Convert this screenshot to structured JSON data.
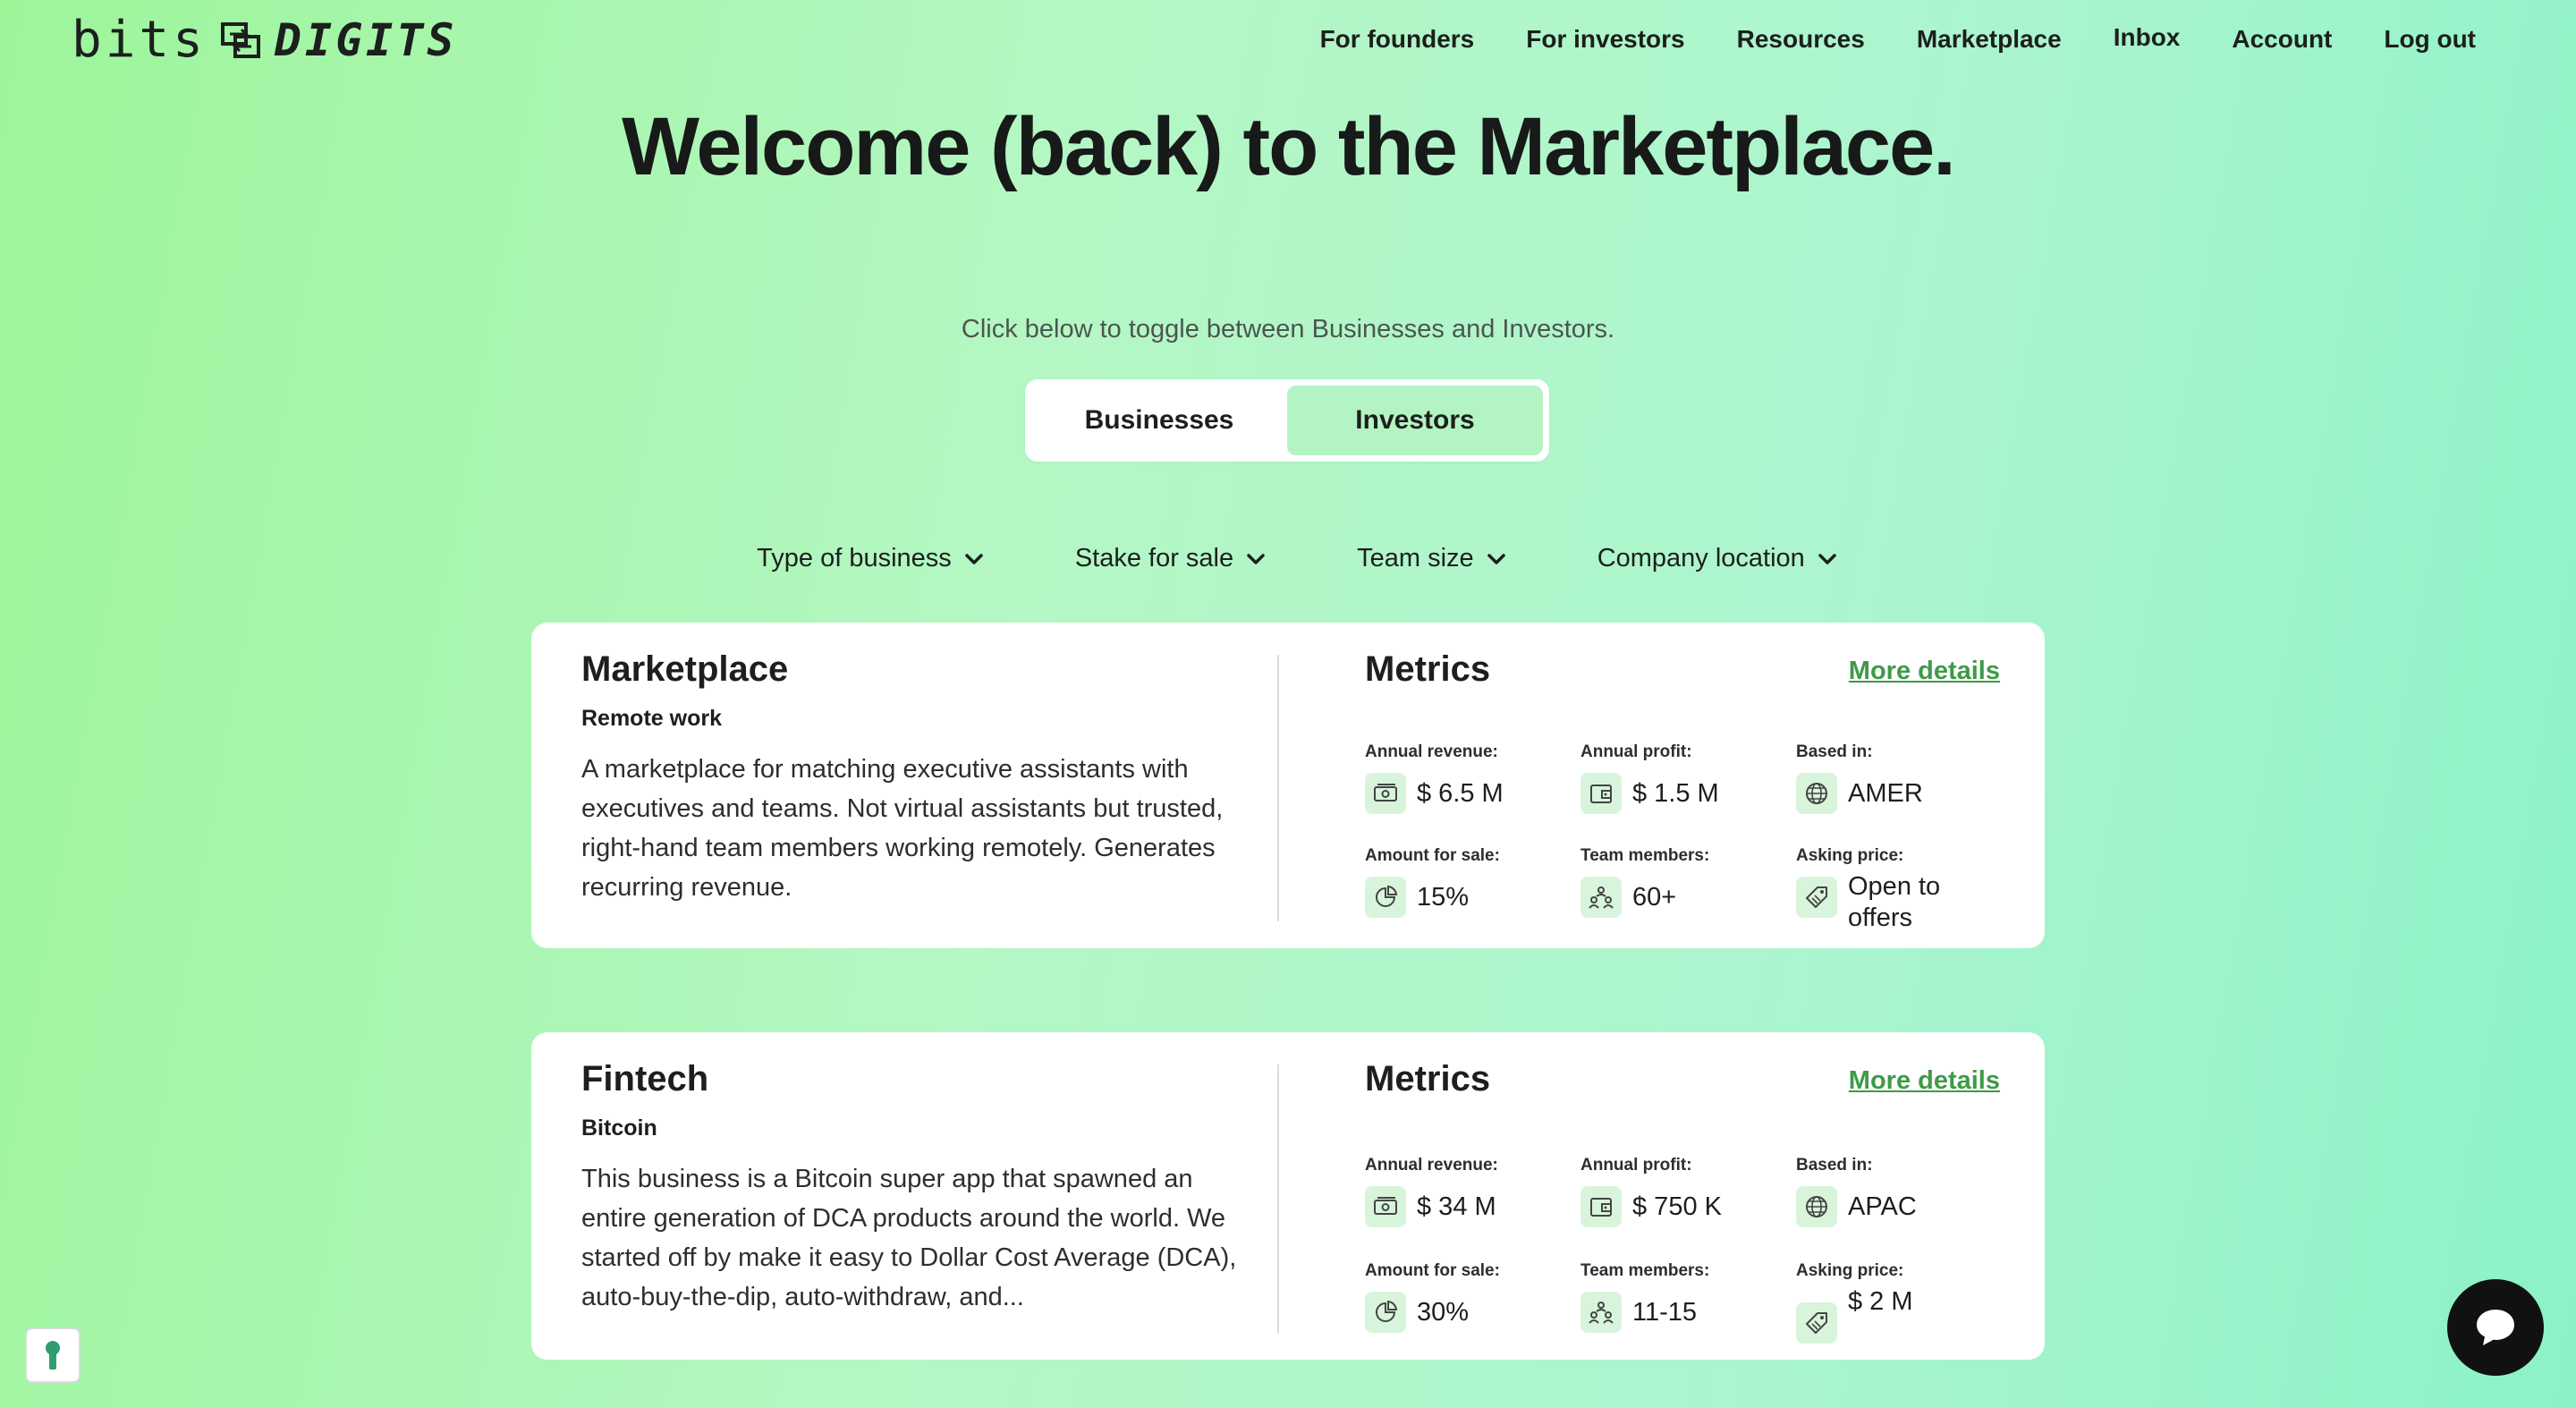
{
  "logo": {
    "part1": "bits",
    "part2": "DIGITS"
  },
  "nav": [
    "For founders",
    "For investors",
    "Resources",
    "Marketplace",
    "Inbox",
    "Account",
    "Log out"
  ],
  "hero": {
    "title": "Welcome (back) to the Marketplace.",
    "subtitle": "Click below to toggle between Businesses and Investors."
  },
  "toggle": {
    "businesses": "Businesses",
    "investors": "Investors",
    "active": "Businesses"
  },
  "filters": [
    "Type of business",
    "Stake for sale",
    "Team size",
    "Company location"
  ],
  "listings": [
    {
      "name": "Marketplace",
      "category": "Remote work",
      "description": "A marketplace for matching executive assistants with executives and teams. Not virtual assistants but trusted, right-hand team members working remotely. Generates recurring revenue.",
      "metrics_title": "Metrics",
      "more_details": "More details",
      "metrics": {
        "annual_revenue": {
          "label": "Annual revenue:",
          "value": "$ 6.5 M",
          "icon": "cash-icon"
        },
        "annual_profit": {
          "label": "Annual profit:",
          "value": "$ 1.5 M",
          "icon": "wallet-icon"
        },
        "based_in": {
          "label": "Based in:",
          "value": "AMER",
          "icon": "globe-icon"
        },
        "amount_for_sale": {
          "label": "Amount for sale:",
          "value": "15%",
          "icon": "pie-chart-icon"
        },
        "team_members": {
          "label": "Team members:",
          "value": "60+",
          "icon": "team-icon"
        },
        "asking_price": {
          "label": "Asking price:",
          "value": "Open to offers",
          "icon": "price-tag-icon"
        }
      }
    },
    {
      "name": "Fintech",
      "category": "Bitcoin",
      "description": "This business is a Bitcoin super app that spawned an entire generation of DCA products around the world. We started off by make it easy to Dollar Cost Average (DCA), auto-buy-the-dip, auto-withdraw, and...",
      "metrics_title": "Metrics",
      "more_details": "More details",
      "metrics": {
        "annual_revenue": {
          "label": "Annual revenue:",
          "value": "$ 34 M",
          "icon": "cash-icon"
        },
        "annual_profit": {
          "label": "Annual profit:",
          "value": "$ 750 K",
          "icon": "wallet-icon"
        },
        "based_in": {
          "label": "Based in:",
          "value": "APAC",
          "icon": "globe-icon"
        },
        "amount_for_sale": {
          "label": "Amount for sale:",
          "value": "30%",
          "icon": "pie-chart-icon"
        },
        "team_members": {
          "label": "Team members:",
          "value": "11-15",
          "icon": "team-icon"
        },
        "asking_price": {
          "label": "Asking price:",
          "value": "$ 2 M",
          "icon": "price-tag-icon"
        }
      }
    }
  ],
  "colors": {
    "accent_link": "#3f9a47",
    "icon_bg": "#d8f5dc",
    "toggle_inactive": "#b4f4c4"
  }
}
